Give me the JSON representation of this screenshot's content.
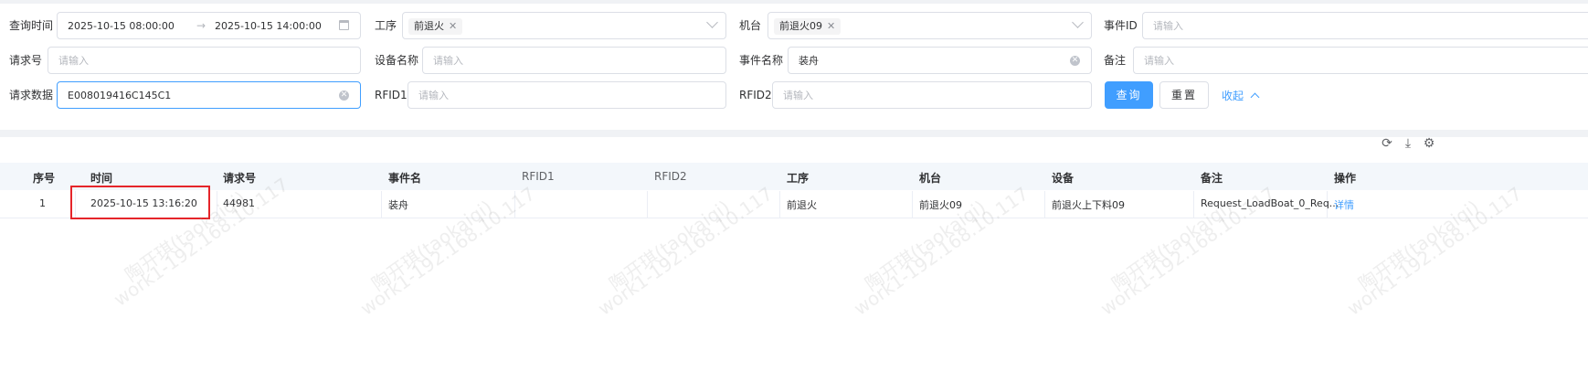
{
  "filters": {
    "query_time": {
      "label": "查询时间",
      "start": "2025-10-15 08:00:00",
      "separator": "→",
      "end": "2025-10-15 14:00:00"
    },
    "process": {
      "label": "工序",
      "tag": "前退火"
    },
    "machine": {
      "label": "机台",
      "tag": "前退火09"
    },
    "event_id": {
      "label": "事件ID",
      "placeholder": "请输入"
    },
    "request_no": {
      "label": "请求号",
      "placeholder": "请输入"
    },
    "device_name": {
      "label": "设备名称",
      "placeholder": "请输入"
    },
    "event_name": {
      "label": "事件名称",
      "value": "装舟"
    },
    "remark": {
      "label": "备注",
      "placeholder": "请输入"
    },
    "request_data": {
      "label": "请求数据",
      "value": "E008019416C145C1"
    },
    "rfid1": {
      "label": "RFID1",
      "placeholder": "请输入"
    },
    "rfid2": {
      "label": "RFID2",
      "placeholder": "请输入"
    }
  },
  "buttons": {
    "query": "查询",
    "reset": "重置",
    "collapse": "收起"
  },
  "table": {
    "headers": {
      "seq": "序号",
      "time": "时间",
      "request_no": "请求号",
      "event_name": "事件名",
      "rfid1": "RFID1",
      "rfid2": "RFID2",
      "process": "工序",
      "machine": "机台",
      "device": "设备",
      "remark": "备注",
      "action": "操作"
    },
    "rows": [
      {
        "seq": "1",
        "time": "2025-10-15 13:16:20",
        "request_no": "44981",
        "event_name": "装舟",
        "rfid1": "",
        "rfid2": "",
        "process": "前退火",
        "machine": "前退火09",
        "device": "前退火上下料09",
        "remark": "Request_LoadBoat_0_Req...",
        "action": "详情"
      }
    ]
  },
  "watermark": {
    "name": "陶开琪(taokaiqi)",
    "host": "work1-192.168.10.117"
  }
}
